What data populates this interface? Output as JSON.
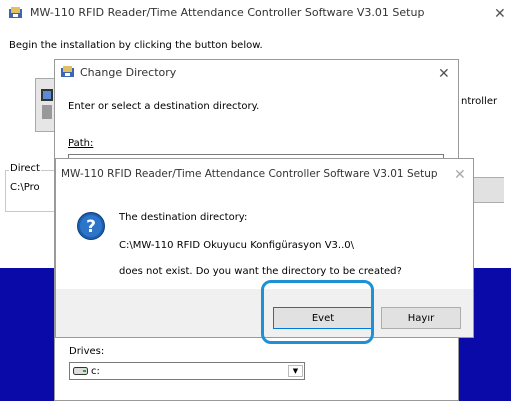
{
  "setup_window": {
    "title": "MW-110 RFID Reader/Time Attendance Controller Software V3.01 Setup",
    "instruction": "Begin the installation by clicking the button below.",
    "install_label_partial": "ntroller",
    "directory_label_partial": "Direct",
    "directory_value_partial": "C:\\Pro"
  },
  "change_directory": {
    "title": "Change Directory",
    "instruction": "Enter or select a destination directory.",
    "path_label": "Path:",
    "path_value_partial": "C:\\MW-110 RFID Okuyucu Konfigürasyon V3..0\\",
    "drives_label": "Drives:",
    "drive_value": "c:"
  },
  "dialog": {
    "title": "MW-110 RFID Reader/Time Attendance Controller Software V3.01 Setup",
    "line1": "The destination directory:",
    "line2": "C:\\MW-110 RFID Okuyucu Konfigürasyon V3..0\\",
    "line3": "does not exist. Do you want the directory to be created?",
    "yes_label": "Evet",
    "no_label": "Hayır"
  },
  "colors": {
    "background": "#0a0aa8",
    "highlight": "#1e90d6",
    "question_icon": "#1c5fb0"
  }
}
